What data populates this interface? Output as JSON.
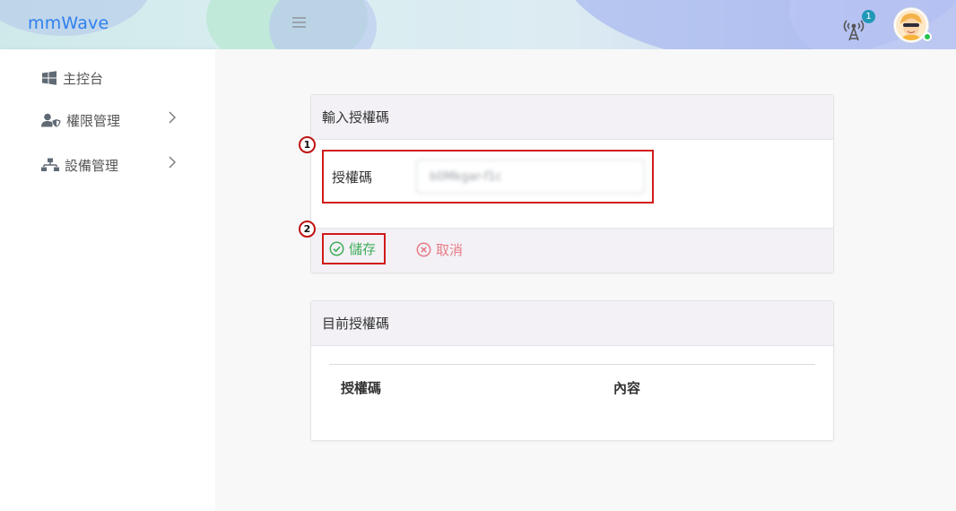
{
  "header": {
    "brand": "mmWave",
    "notification_count": "1"
  },
  "sidebar": {
    "items": [
      {
        "label": "主控台",
        "icon": "windows-icon",
        "has_submenu": false
      },
      {
        "label": "權限管理",
        "icon": "user-shield-icon",
        "has_submenu": true
      },
      {
        "label": "設備管理",
        "icon": "sitemap-icon",
        "has_submenu": true
      }
    ]
  },
  "input_card": {
    "title": "輸入授權碼",
    "field_label": "授權碼",
    "field_value": "b0Mkgar-f1c",
    "save_label": "儲存",
    "cancel_label": "取消",
    "markers": [
      "1",
      "2"
    ]
  },
  "current_card": {
    "title": "目前授權碼",
    "columns": [
      "授權碼",
      "內容"
    ]
  },
  "colors": {
    "brand": "#2f80ed",
    "save": "#3fae5b",
    "cancel": "#e77c86",
    "highlight": "#d11a1a",
    "badge": "#1f98b5"
  }
}
